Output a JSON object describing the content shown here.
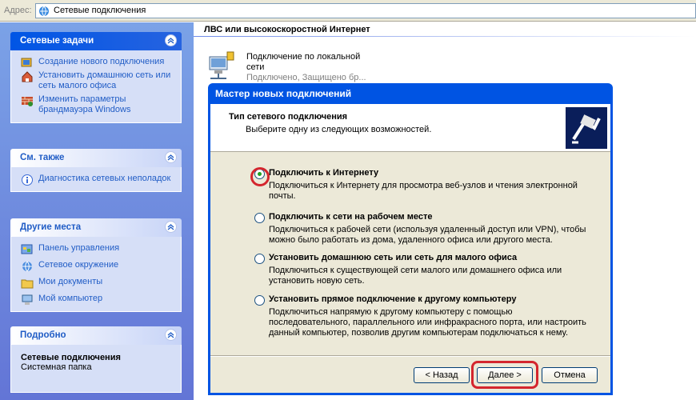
{
  "address_bar": {
    "label": "Адрес:",
    "value": "Сетевые подключения"
  },
  "sidebar": {
    "network_tasks": {
      "title": "Сетевые задачи",
      "items": [
        {
          "label": "Создание нового подключения",
          "icon": "new-connection-icon"
        },
        {
          "label": "Установить домашнюю сеть или сеть малого офиса",
          "icon": "home-network-icon"
        },
        {
          "label": "Изменить параметры брандмауэра Windows",
          "icon": "firewall-icon"
        }
      ]
    },
    "see_also": {
      "title": "См. также",
      "items": [
        {
          "label": "Диагностика сетевых неполадок",
          "icon": "info-icon"
        }
      ]
    },
    "other_places": {
      "title": "Другие места",
      "items": [
        {
          "label": "Панель управления",
          "icon": "control-panel-icon"
        },
        {
          "label": "Сетевое окружение",
          "icon": "network-places-icon"
        },
        {
          "label": "Мои документы",
          "icon": "documents-icon"
        },
        {
          "label": "Мой компьютер",
          "icon": "computer-icon"
        }
      ]
    },
    "details": {
      "title": "Подробно",
      "name": "Сетевые подключения",
      "type": "Системная папка"
    }
  },
  "main": {
    "group_title": "ЛВС или высокоскоростной Интернет",
    "connection": {
      "name": "Подключение по локальной сети",
      "status": "Подключено, Защищено бр..."
    }
  },
  "wizard": {
    "title": "Мастер новых подключений",
    "header_title": "Тип сетевого подключения",
    "header_subtitle": "Выберите одну из следующих возможностей.",
    "options": [
      {
        "label": "Подключить к Интернету",
        "desc": "Подключиться к Интернету для просмотра веб-узлов и чтения  электронной почты.",
        "selected": true
      },
      {
        "label": "Подключить к сети на рабочем месте",
        "desc": "Подключиться к рабочей сети (используя удаленный доступ или VPN), чтобы можно было работать из дома, удаленного офиса или другого места.",
        "selected": false
      },
      {
        "label": "Установить домашнюю сеть или сеть для малого офиса",
        "desc": "Подключиться к существующей сети малого или домашнего офиса или установить новую сеть.",
        "selected": false
      },
      {
        "label": "Установить прямое подключение к другому компьютеру",
        "desc": "Подключиться напрямую к другому компьютеру с помощью последовательного, параллельного или инфракрасного порта, или настроить данный компьютер, позволив другим  компьютерам подключаться к нему.",
        "selected": false
      }
    ],
    "buttons": {
      "back": "< Назад",
      "next": "Далее >",
      "cancel": "Отмена"
    }
  },
  "colors": {
    "highlight": "#d4262e",
    "title_bar": "#0054e3",
    "link": "#215dc6"
  }
}
